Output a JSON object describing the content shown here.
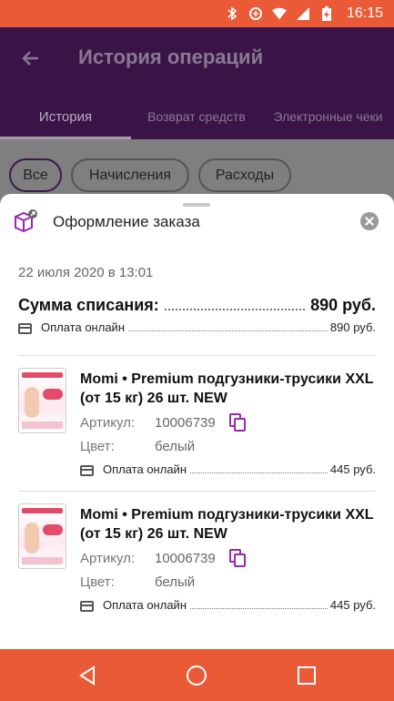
{
  "status_bar": {
    "time": "16:15",
    "icons": [
      "bluetooth-icon",
      "data-saver-icon",
      "wifi-icon",
      "signal-icon",
      "battery-charging-icon"
    ]
  },
  "app_bar": {
    "title": "История операций",
    "tabs": [
      {
        "label": "История",
        "active": true
      },
      {
        "label": "Возврат средств",
        "active": false
      },
      {
        "label": "Электронные чеки",
        "active": false
      }
    ]
  },
  "filters": {
    "chips": [
      {
        "label": "Все",
        "selected": true
      },
      {
        "label": "Начисления",
        "selected": false
      },
      {
        "label": "Расходы",
        "selected": false
      }
    ]
  },
  "sheet": {
    "title": "Оформление заказа",
    "date": "22 июля 2020 в 13:01",
    "total_label": "Сумма списания:",
    "total_value": "890 руб.",
    "payment_label": "Оплата онлайн",
    "payment_value": "890 руб.",
    "items": [
      {
        "name": "Momi • Premium подгузники-трусики XXL (от 15 кг) 26 шт. NEW",
        "article_label": "Артикул:",
        "article": "10006739",
        "color_label": "Цвет:",
        "color": "белый",
        "payment_label": "Оплата онлайн",
        "payment_value": "445 руб."
      },
      {
        "name": "Momi • Premium подгузники-трусики XXL (от 15 кг) 26 шт. NEW",
        "article_label": "Артикул:",
        "article": "10006739",
        "color_label": "Цвет:",
        "color": "белый",
        "payment_label": "Оплата онлайн",
        "payment_value": "445 руб."
      }
    ]
  },
  "colors": {
    "status_bar": "#ea5a37",
    "app_bar_dimmed": "#3a1447",
    "accent_purple": "#9b27b0"
  }
}
